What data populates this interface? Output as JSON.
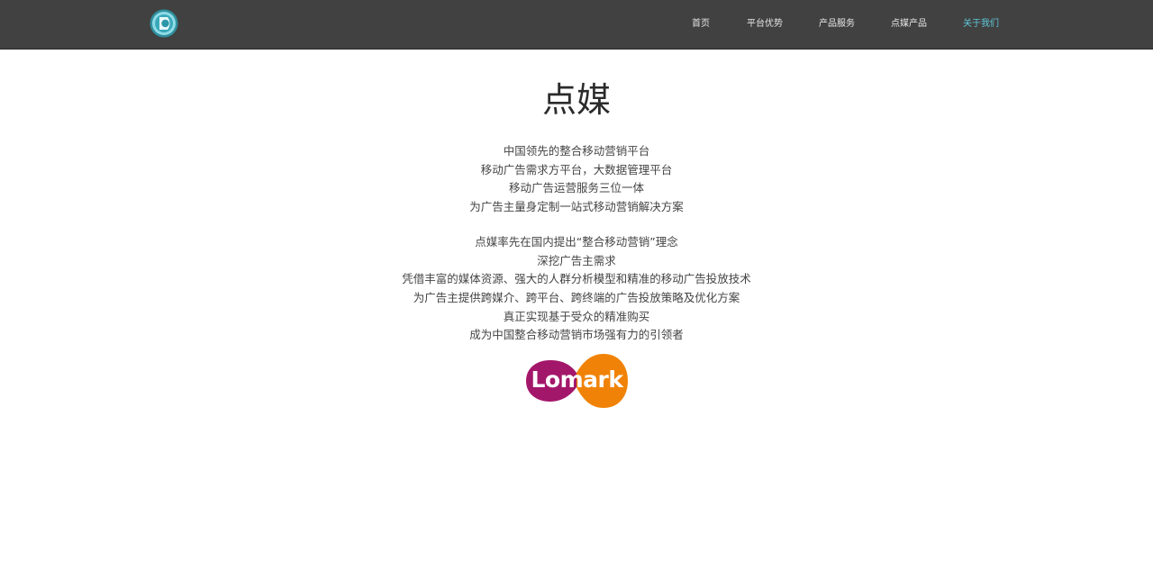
{
  "header": {
    "logo_icon": "circular-teal-logo-icon",
    "nav": [
      {
        "label": "首页",
        "active": false
      },
      {
        "label": "平台优势",
        "active": false
      },
      {
        "label": "产品服务",
        "active": false
      },
      {
        "label": "点媒产品",
        "active": false
      },
      {
        "label": "关于我们",
        "active": true
      }
    ]
  },
  "main": {
    "title": "点媒",
    "paragraph1": [
      "中国领先的整合移动营销平台",
      "移动广告需求方平台，大数据管理平台",
      "移动广告运营服务三位一体",
      "为广告主量身定制一站式移动营销解决方案"
    ],
    "paragraph2": [
      "点媒率先在国内提出“整合移动营销”理念",
      "深挖广告主需求",
      "凭借丰富的媒体资源、强大的人群分析模型和精准的移动广告投放技术",
      "为广告主提供跨媒介、跨平台、跨终端的广告投放策略及优化方案",
      "真正实现基于受众的精准购买",
      "成为中国整合移动营销市场强有力的引领者"
    ],
    "brand_logo_text": "Lomark"
  },
  "colors": {
    "nav_bg": "#414141",
    "nav_text": "#e6e6e6",
    "nav_active": "#5fc7d8",
    "logo_magenta": "#a3176a",
    "logo_orange": "#f08307"
  }
}
